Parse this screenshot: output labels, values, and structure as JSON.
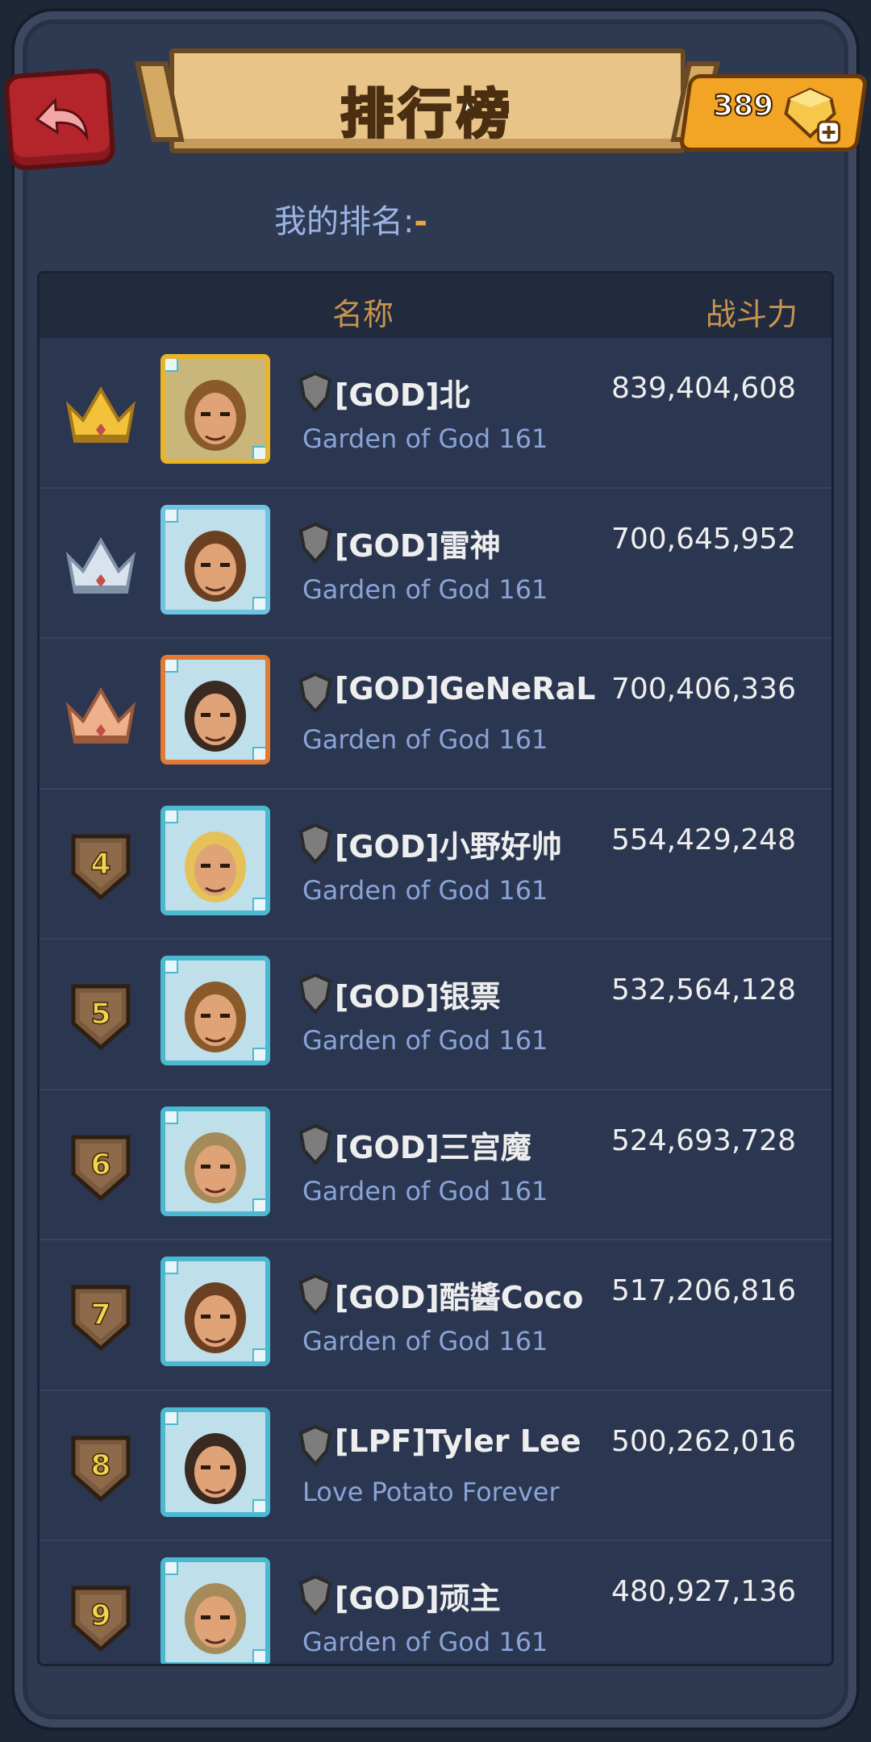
{
  "header": {
    "title": "排行榜",
    "gems": "389"
  },
  "my_rank": {
    "label": "我的排名:",
    "value": "-"
  },
  "table": {
    "col_name": "名称",
    "col_power": "战斗力",
    "rows": [
      {
        "rank": "1",
        "badge": "gold-crown",
        "name": "[GOD]北",
        "guild": "Garden of God 161",
        "power": "839,404,608",
        "avatar": "bearded-warrior",
        "avatar_color": "#8a5a2b"
      },
      {
        "rank": "2",
        "badge": "silver-crown",
        "name": "[GOD]雷神",
        "guild": "Garden of God 161",
        "power": "700,645,952",
        "avatar": "female-warrior",
        "avatar_color": "#6b3f22"
      },
      {
        "rank": "3",
        "badge": "bronze-crown",
        "name": "[GOD]GeNeRaL",
        "guild": "Garden of God 161",
        "power": "700,406,336",
        "avatar": "long-hair-warrior",
        "avatar_color": "#3a2a22"
      },
      {
        "rank": "4",
        "badge": "shield",
        "name": "[GOD]小野好帅",
        "guild": "Garden of God 161",
        "power": "554,429,248",
        "avatar": "blonde-warrior",
        "avatar_color": "#e6c15a"
      },
      {
        "rank": "5",
        "badge": "shield",
        "name": "[GOD]银票",
        "guild": "Garden of God 161",
        "power": "532,564,128",
        "avatar": "bearded-warrior",
        "avatar_color": "#8a5a2b"
      },
      {
        "rank": "6",
        "badge": "shield",
        "name": "[GOD]三宫魔",
        "guild": "Garden of God 161",
        "power": "524,693,728",
        "avatar": "helmeted-beast",
        "avatar_color": "#a58a5a"
      },
      {
        "rank": "7",
        "badge": "shield",
        "name": "[GOD]酷醬Coco",
        "guild": "Garden of God 161",
        "power": "517,206,816",
        "avatar": "female-warrior",
        "avatar_color": "#6b3f22"
      },
      {
        "rank": "8",
        "badge": "shield",
        "name": "[LPF]Tyler Lee",
        "guild": "Love Potato Forever",
        "power": "500,262,016",
        "avatar": "long-hair-warrior",
        "avatar_color": "#3a2a22"
      },
      {
        "rank": "9",
        "badge": "shield",
        "name": "[GOD]顽主",
        "guild": "Garden of God 161",
        "power": "480,927,136",
        "avatar": "helmeted-beast",
        "avatar_color": "#a58a5a"
      }
    ]
  },
  "colors": {
    "background": "#2e3a52",
    "accent_orange": "#c8944d",
    "guild_text": "#8aa4d8",
    "gold": "#e8b52a",
    "silver": "#cfd8e3",
    "bronze": "#e49a74"
  }
}
